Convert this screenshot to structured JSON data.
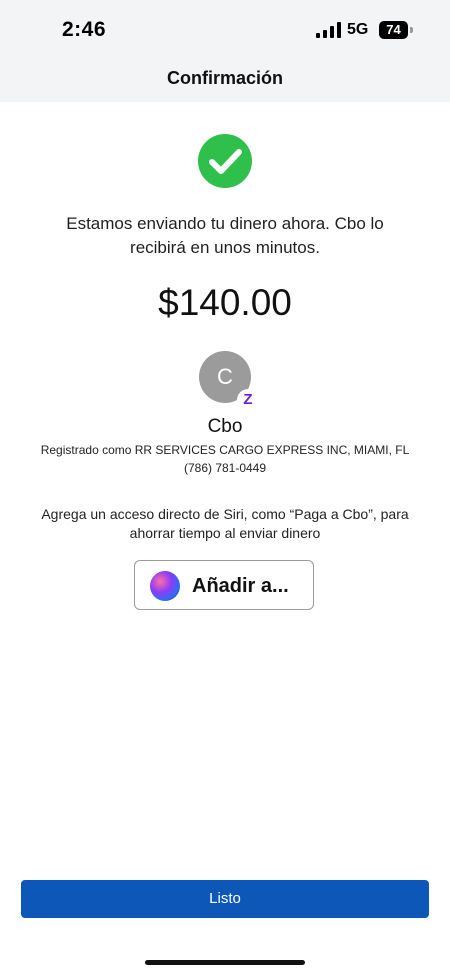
{
  "status_bar": {
    "time": "2:46",
    "network": "5G",
    "battery": "74"
  },
  "header": {
    "title": "Confirmación"
  },
  "confirmation": {
    "message": "Estamos enviando tu dinero ahora. Cbo lo recibirá en unos minutos.",
    "amount": "$140.00"
  },
  "recipient": {
    "avatar_initial": "C",
    "badge": "Z",
    "name": "Cbo",
    "registered_as": "Registrado como RR SERVICES CARGO EXPRESS INC, MIAMI, FL",
    "phone": "(786) 781-0449"
  },
  "siri": {
    "text": "Agrega un acceso directo de Siri, como “Paga a Cbo”, para ahorrar tiempo al enviar dinero",
    "button_label": "Añadir a..."
  },
  "footer": {
    "done_label": "Listo"
  },
  "colors": {
    "success_green": "#2fbf4b",
    "primary_blue": "#0d57b9",
    "zelle_purple": "#6d1ed4"
  }
}
